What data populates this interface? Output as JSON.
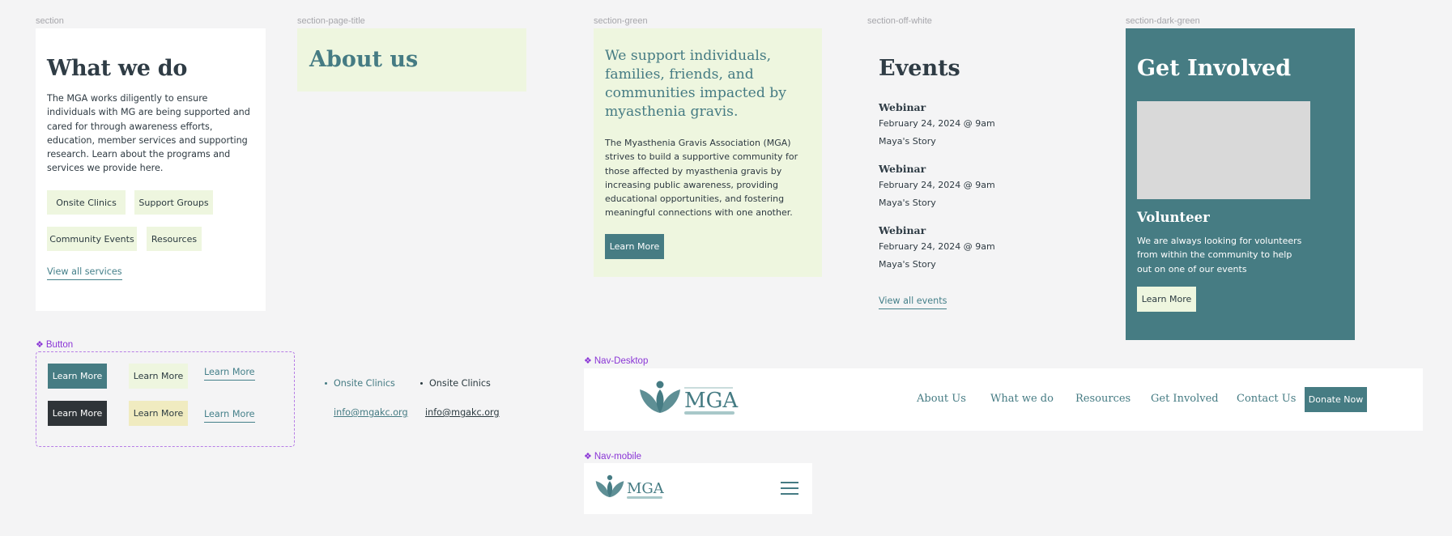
{
  "labels": {
    "section": "section",
    "section_page_title": "section-page-title",
    "section_green": "section-green",
    "section_off_white": "section-off-white",
    "section_dark_green": "section-dark-green",
    "button_component": "Button",
    "nav_desktop": "Nav-Desktop",
    "nav_mobile": "Nav-mobile"
  },
  "what_we_do": {
    "title": "What we do",
    "body": "The MGA works diligently to ensure individuals with MG are being supported and cared for through awareness efforts, education, member services and supporting research. Learn about the programs and services we provide here.",
    "chips": [
      "Onsite Clinics",
      "Support Groups",
      "Community Events",
      "Resources"
    ],
    "link": "View all services"
  },
  "about": {
    "title": "About us"
  },
  "support": {
    "heading": "We support individuals, families, friends, and communities impacted by myasthenia gravis.",
    "body": "The Myasthenia Gravis Association (MGA) strives to build a supportive community for those affected by myasthenia gravis by increasing public awareness, providing educational opportunities, and fostering meaningful connections with one another.",
    "button": "Learn More"
  },
  "events": {
    "title": "Events",
    "items": [
      {
        "type": "Webinar",
        "date": "February 24, 2024 @ 9am",
        "name": "Maya's Story"
      },
      {
        "type": "Webinar",
        "date": "February 24, 2024 @ 9am",
        "name": "Maya's Story"
      },
      {
        "type": "Webinar",
        "date": "February 24, 2024 @ 9am",
        "name": "Maya's Story"
      }
    ],
    "link": "View all events"
  },
  "get_involved": {
    "title": "Get Involved",
    "subtitle": "Volunteer",
    "body": "We are always looking for volunteers from within the community to help out on one of our events",
    "button": "Learn More"
  },
  "buttons": {
    "label": "Learn More"
  },
  "list_items": {
    "item": "Onsite Clinics",
    "email": "info@mgakc.org"
  },
  "nav": {
    "logo": "MGA",
    "links": [
      "About Us",
      "What we do",
      "Resources",
      "Get Involved",
      "Contact Us"
    ],
    "donate": "Donate Now"
  },
  "colors": {
    "teal": "#467c83",
    "mint": "#eef6df",
    "dark": "#2f3438",
    "yellow": "#f0ebc0",
    "purple": "#8a35d6"
  }
}
